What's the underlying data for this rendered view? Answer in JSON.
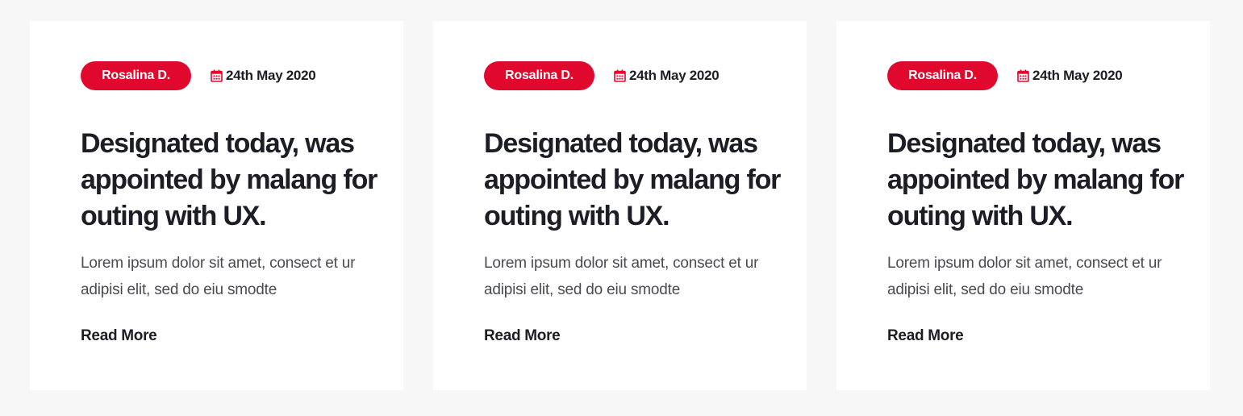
{
  "colors": {
    "page_background": "#f7f7f7",
    "card_background": "#ffffff",
    "accent": "#e0082d",
    "heading": "#1d1d25",
    "body_text": "#4a4a52"
  },
  "cards": [
    {
      "author": "Rosalina D.",
      "date": "24th May 2020",
      "date_icon": "calendar-icon",
      "title": "Designated today, was appointed by malang for outing with UX.",
      "excerpt": "Lorem ipsum dolor sit amet, consect et ur adipisi elit, sed do eiu smodte",
      "read_more": "Read More"
    },
    {
      "author": "Rosalina D.",
      "date": "24th May 2020",
      "date_icon": "calendar-icon",
      "title": "Designated today, was appointed by malang for outing with UX.",
      "excerpt": "Lorem ipsum dolor sit amet, consect et ur adipisi elit, sed do eiu smodte",
      "read_more": "Read More"
    },
    {
      "author": "Rosalina D.",
      "date": "24th May 2020",
      "date_icon": "calendar-icon",
      "title": "Designated today, was appointed by malang for outing with UX.",
      "excerpt": "Lorem ipsum dolor sit amet, consect et ur adipisi elit, sed do eiu smodte",
      "read_more": "Read More"
    }
  ]
}
